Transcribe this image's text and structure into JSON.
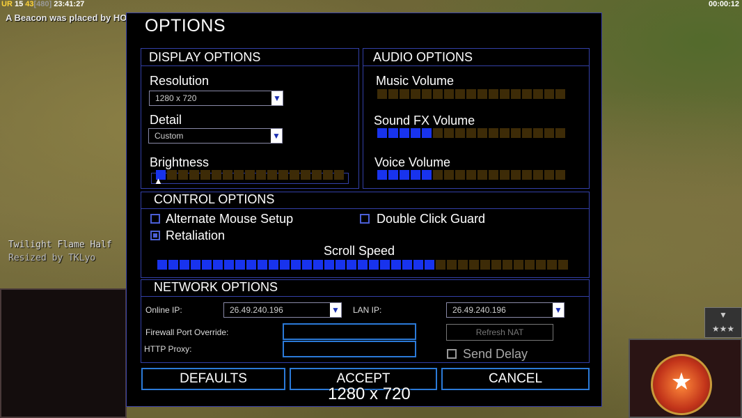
{
  "hud": {
    "stats_prefix": "UR",
    "stat1": "15",
    "stat2": "43",
    "stat3": "[480]",
    "time": "23:41:27",
    "clock": "00:00:12",
    "beacon_message": "A Beacon was placed by HOGEE",
    "map_line1": "Twilight Flame Half",
    "map_line2": "Resized by TKLyo"
  },
  "dialog": {
    "title": "OPTIONS",
    "display": {
      "header": "DISPLAY OPTIONS",
      "resolution_label": "Resolution",
      "resolution_value": "1280 x 720",
      "detail_label": "Detail",
      "detail_value": "Custom",
      "brightness_label": "Brightness",
      "brightness_level": 1,
      "brightness_total": 17
    },
    "audio": {
      "header": "AUDIO OPTIONS",
      "music_label": "Music Volume",
      "music_level": 0,
      "sfx_label": "Sound FX Volume",
      "sfx_level": 5,
      "voice_label": "Voice Volume",
      "voice_level": 5,
      "total": 17
    },
    "control": {
      "header": "CONTROL OPTIONS",
      "alt_mouse_label": "Alternate Mouse Setup",
      "alt_mouse_checked": false,
      "double_click_label": "Double Click Guard",
      "double_click_checked": false,
      "retaliation_label": "Retaliation",
      "retaliation_checked": true,
      "scroll_label": "Scroll Speed",
      "scroll_level": 25,
      "scroll_total": 37
    },
    "network": {
      "header": "NETWORK OPTIONS",
      "online_ip_label": "Online IP:",
      "online_ip_value": "26.49.240.196",
      "lan_ip_label": "LAN IP:",
      "lan_ip_value": "26.49.240.196",
      "firewall_label": "Firewall Port Override:",
      "firewall_value": "",
      "proxy_label": "HTTP Proxy:",
      "proxy_value": "",
      "refresh_nat_label": "Refresh NAT",
      "send_delay_label": "Send Delay",
      "send_delay_checked": false
    },
    "buttons": {
      "defaults": "DEFAULTS",
      "accept": "ACCEPT",
      "cancel": "CANCEL"
    },
    "tooltip": "1280 x 720"
  },
  "colors": {
    "segment_on": "#1833ee",
    "segment_off": "#3d2b07",
    "border": "#3340a8",
    "button_border": "#2b7ad8"
  }
}
